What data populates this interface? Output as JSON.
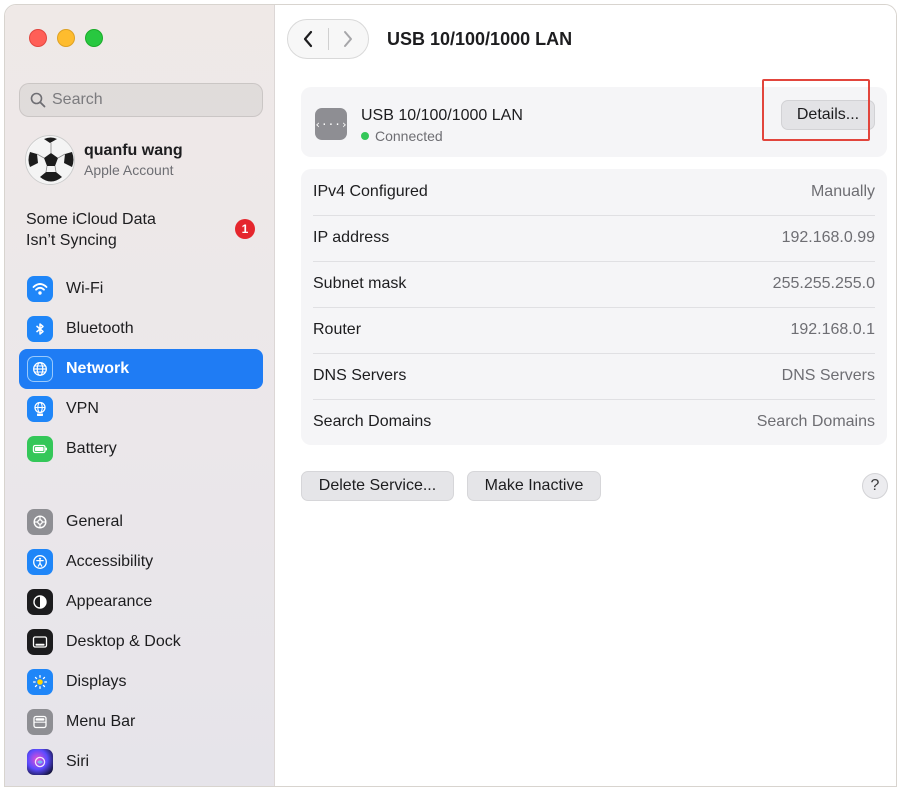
{
  "window": {
    "title": "USB 10/100/1000 LAN"
  },
  "sidebar": {
    "search": {
      "placeholder": "Search",
      "value": ""
    },
    "account": {
      "name": "quanfu wang",
      "subtitle": "Apple Account"
    },
    "icloud": {
      "line1": "Some iCloud Data",
      "line2": "Isn’t Syncing",
      "badge": "1"
    },
    "items_group1": [
      {
        "label": "Wi-Fi",
        "icon": "wifi-icon",
        "color": "#1f86f8"
      },
      {
        "label": "Bluetooth",
        "icon": "bluetooth-icon",
        "color": "#1f86f8"
      },
      {
        "label": "Network",
        "icon": "globe-icon",
        "color": "#1f86f8",
        "active": true
      },
      {
        "label": "VPN",
        "icon": "vpn-globe-icon",
        "color": "#1f86f8"
      },
      {
        "label": "Battery",
        "icon": "battery-icon",
        "color": "#34c759"
      }
    ],
    "items_group2": [
      {
        "label": "General",
        "icon": "gear-icon",
        "color": "#8e8e93"
      },
      {
        "label": "Accessibility",
        "icon": "accessibility-icon",
        "color": "#1f86f8"
      },
      {
        "label": "Appearance",
        "icon": "appearance-icon",
        "color": "#1c1c1e"
      },
      {
        "label": "Desktop & Dock",
        "icon": "dock-icon",
        "color": "#1c1c1e"
      },
      {
        "label": "Displays",
        "icon": "sun-icon",
        "color": "#1f86f8"
      },
      {
        "label": "Menu Bar",
        "icon": "menubar-icon",
        "color": "#8e8e93"
      },
      {
        "label": "Siri",
        "icon": "siri-icon",
        "color": "#2b2b5e"
      }
    ]
  },
  "service": {
    "name": "USB 10/100/1000 LAN",
    "status": "Connected",
    "icon_text": "‹···›",
    "details_label": "Details..."
  },
  "info_rows": [
    {
      "label": "IPv4 Configured",
      "value": "Manually"
    },
    {
      "label": "IP address",
      "value": "192.168.0.99"
    },
    {
      "label": "Subnet mask",
      "value": "255.255.255.0"
    },
    {
      "label": "Router",
      "value": "192.168.0.1"
    },
    {
      "label": "DNS Servers",
      "value": "DNS Servers"
    },
    {
      "label": "Search Domains",
      "value": "Search Domains"
    }
  ],
  "actions": {
    "delete": "Delete Service...",
    "inactive": "Make Inactive",
    "help": "?"
  },
  "colors": {
    "accent": "#1f7cf4",
    "connected": "#34c759",
    "highlight": "#e2453c",
    "badge": "#e5262d"
  }
}
